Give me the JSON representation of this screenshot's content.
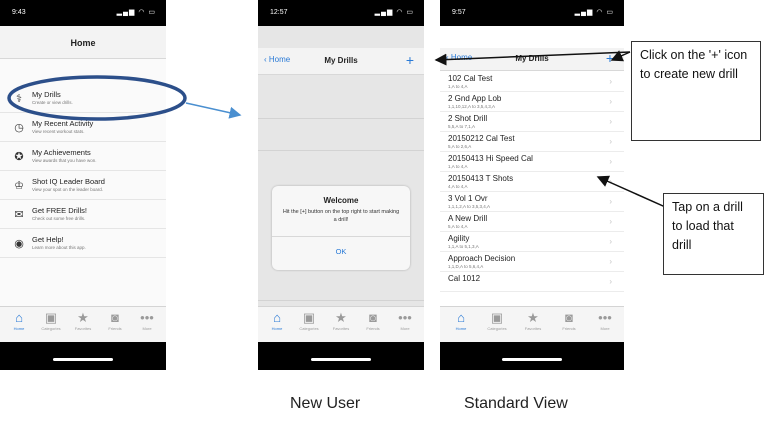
{
  "colors": {
    "accent": "#2a7ad6",
    "callout_arrow": "#4a8fd0",
    "highlight_ellipse": "#2c4f8a"
  },
  "tabbar": {
    "items": [
      {
        "label": "Home",
        "icon": "house-icon",
        "glyph": "⌂"
      },
      {
        "label": "Categories",
        "icon": "image-icon",
        "glyph": "▣"
      },
      {
        "label": "Favorites",
        "icon": "star-icon",
        "glyph": "★"
      },
      {
        "label": "Friends",
        "icon": "person-card-icon",
        "glyph": "◙"
      },
      {
        "label": "More",
        "icon": "more-icon",
        "glyph": "•••"
      }
    ]
  },
  "phone1": {
    "time": "9:43",
    "title": "Home",
    "menu": [
      {
        "title": "My Drills",
        "subtitle": "Create or view drills.",
        "icon": "drill-icon",
        "glyph": "⚕"
      },
      {
        "title": "My Recent Activity",
        "subtitle": "View recent workout stats.",
        "icon": "clock-icon",
        "glyph": "◷"
      },
      {
        "title": "My Achievements",
        "subtitle": "View awards that you have won.",
        "icon": "medal-icon",
        "glyph": "✪"
      },
      {
        "title": "Shot IQ Leader Board",
        "subtitle": "View your spot on the leader board.",
        "icon": "trophy-icon",
        "glyph": "♔"
      },
      {
        "title": "Get FREE Drills!",
        "subtitle": "Check out some free drills.",
        "icon": "gift-icon",
        "glyph": "✉"
      },
      {
        "title": "Get Help!",
        "subtitle": "Learn more about this app.",
        "icon": "help-icon",
        "glyph": "◉"
      }
    ]
  },
  "phone2": {
    "time": "12:57",
    "back": "Home",
    "title": "My Drills",
    "plus": "+",
    "dialog": {
      "title": "Welcome",
      "message": "Hit the [+] button on the top right to start making a drill!",
      "ok": "OK"
    }
  },
  "phone3": {
    "time": "9:57",
    "back": "Home",
    "title": "My Drills",
    "plus": "+",
    "drills": [
      {
        "name": "102 Cal Test",
        "sub": "1,A to 4,A"
      },
      {
        "name": "2 Gnd App Lob",
        "sub": "1,1,10,12,A to 3,5,4,3,A"
      },
      {
        "name": "2 Shot Drill",
        "sub": "5,5,A to 7,1,A"
      },
      {
        "name": "20150212 Cal Test",
        "sub": "5,A to 2,6,A"
      },
      {
        "name": "20150413 Hi Speed Cal",
        "sub": "1,A to 4,A"
      },
      {
        "name": "20150413 T Shots",
        "sub": "4,A to 4,A"
      },
      {
        "name": "3 Vol 1 Ovr",
        "sub": "1,1,1,2,A to 3,5,3,4,A"
      },
      {
        "name": "A New Drill",
        "sub": "5,A to 4,A"
      },
      {
        "name": "Agility",
        "sub": "1,1,A to 5,1,3,A"
      },
      {
        "name": "Approach Decision",
        "sub": "1,1,D,A to 5,6,4,A"
      },
      {
        "name": "Cal 1012",
        "sub": ""
      }
    ]
  },
  "annotations": {
    "callout_top": "Click on the '+' icon to create new drill",
    "callout_bottom": "Tap on a drill to load that drill",
    "caption_new_user": "New User",
    "caption_standard": "Standard View"
  }
}
